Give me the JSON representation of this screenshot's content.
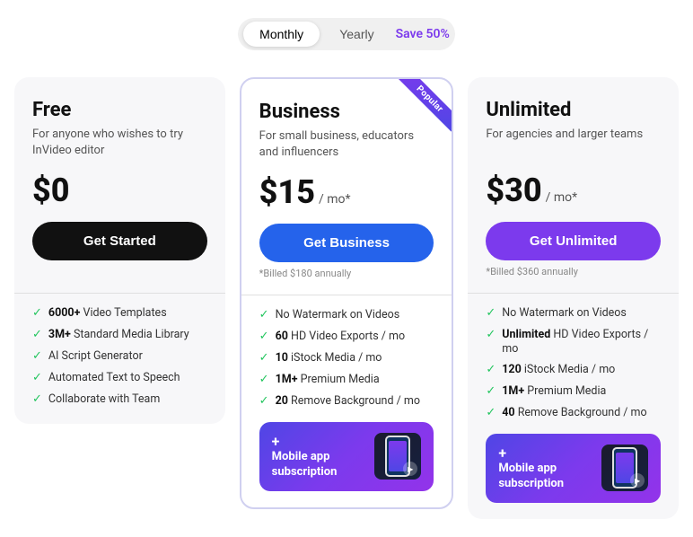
{
  "toggle": {
    "monthly_label": "Monthly",
    "yearly_label": "Yearly",
    "save_label": "Save 50%",
    "active": "monthly"
  },
  "plans": [
    {
      "id": "free",
      "name": "Free",
      "description": "For anyone who wishes to try InVideo editor",
      "price": "$0",
      "price_suffix": "",
      "billed_note": "",
      "button_label": "Get Started",
      "button_type": "dark",
      "featured": false,
      "features": [
        {
          "bold": "6000+",
          "text": " Video Templates"
        },
        {
          "bold": "3M+",
          "text": " Standard Media Library"
        },
        {
          "bold": "",
          "text": "AI Script Generator"
        },
        {
          "bold": "",
          "text": "Automated Text to Speech"
        },
        {
          "bold": "",
          "text": "Collaborate with Team"
        }
      ],
      "mobile_banner": false
    },
    {
      "id": "business",
      "name": "Business",
      "description": "For small business, educators and influencers",
      "price": "$15",
      "price_suffix": "/ mo*",
      "billed_note": "*Billed $180 annually",
      "button_label": "Get Business",
      "button_type": "blue",
      "featured": true,
      "popular_label": "Popular",
      "features": [
        {
          "bold": "",
          "text": "No Watermark on Videos"
        },
        {
          "bold": "60",
          "text": " HD Video Exports / mo"
        },
        {
          "bold": "10",
          "text": " iStock Media / mo"
        },
        {
          "bold": "1M+",
          "text": " Premium Media"
        },
        {
          "bold": "20",
          "text": " Remove Background / mo"
        }
      ],
      "mobile_banner": true,
      "mobile_banner_text": "Mobile app subscription"
    },
    {
      "id": "unlimited",
      "name": "Unlimited",
      "description": "For agencies and larger teams",
      "price": "$30",
      "price_suffix": "/ mo*",
      "billed_note": "*Billed $360 annually",
      "button_label": "Get Unlimited",
      "button_type": "purple",
      "featured": false,
      "features": [
        {
          "bold": "",
          "text": "No Watermark on Videos"
        },
        {
          "bold": "Unlimited",
          "text": " HD Video Exports / mo"
        },
        {
          "bold": "120",
          "text": " iStock Media / mo"
        },
        {
          "bold": "1M+",
          "text": " Premium Media"
        },
        {
          "bold": "40",
          "text": " Remove Background / mo"
        }
      ],
      "mobile_banner": true,
      "mobile_banner_text": "Mobile app subscription"
    }
  ]
}
